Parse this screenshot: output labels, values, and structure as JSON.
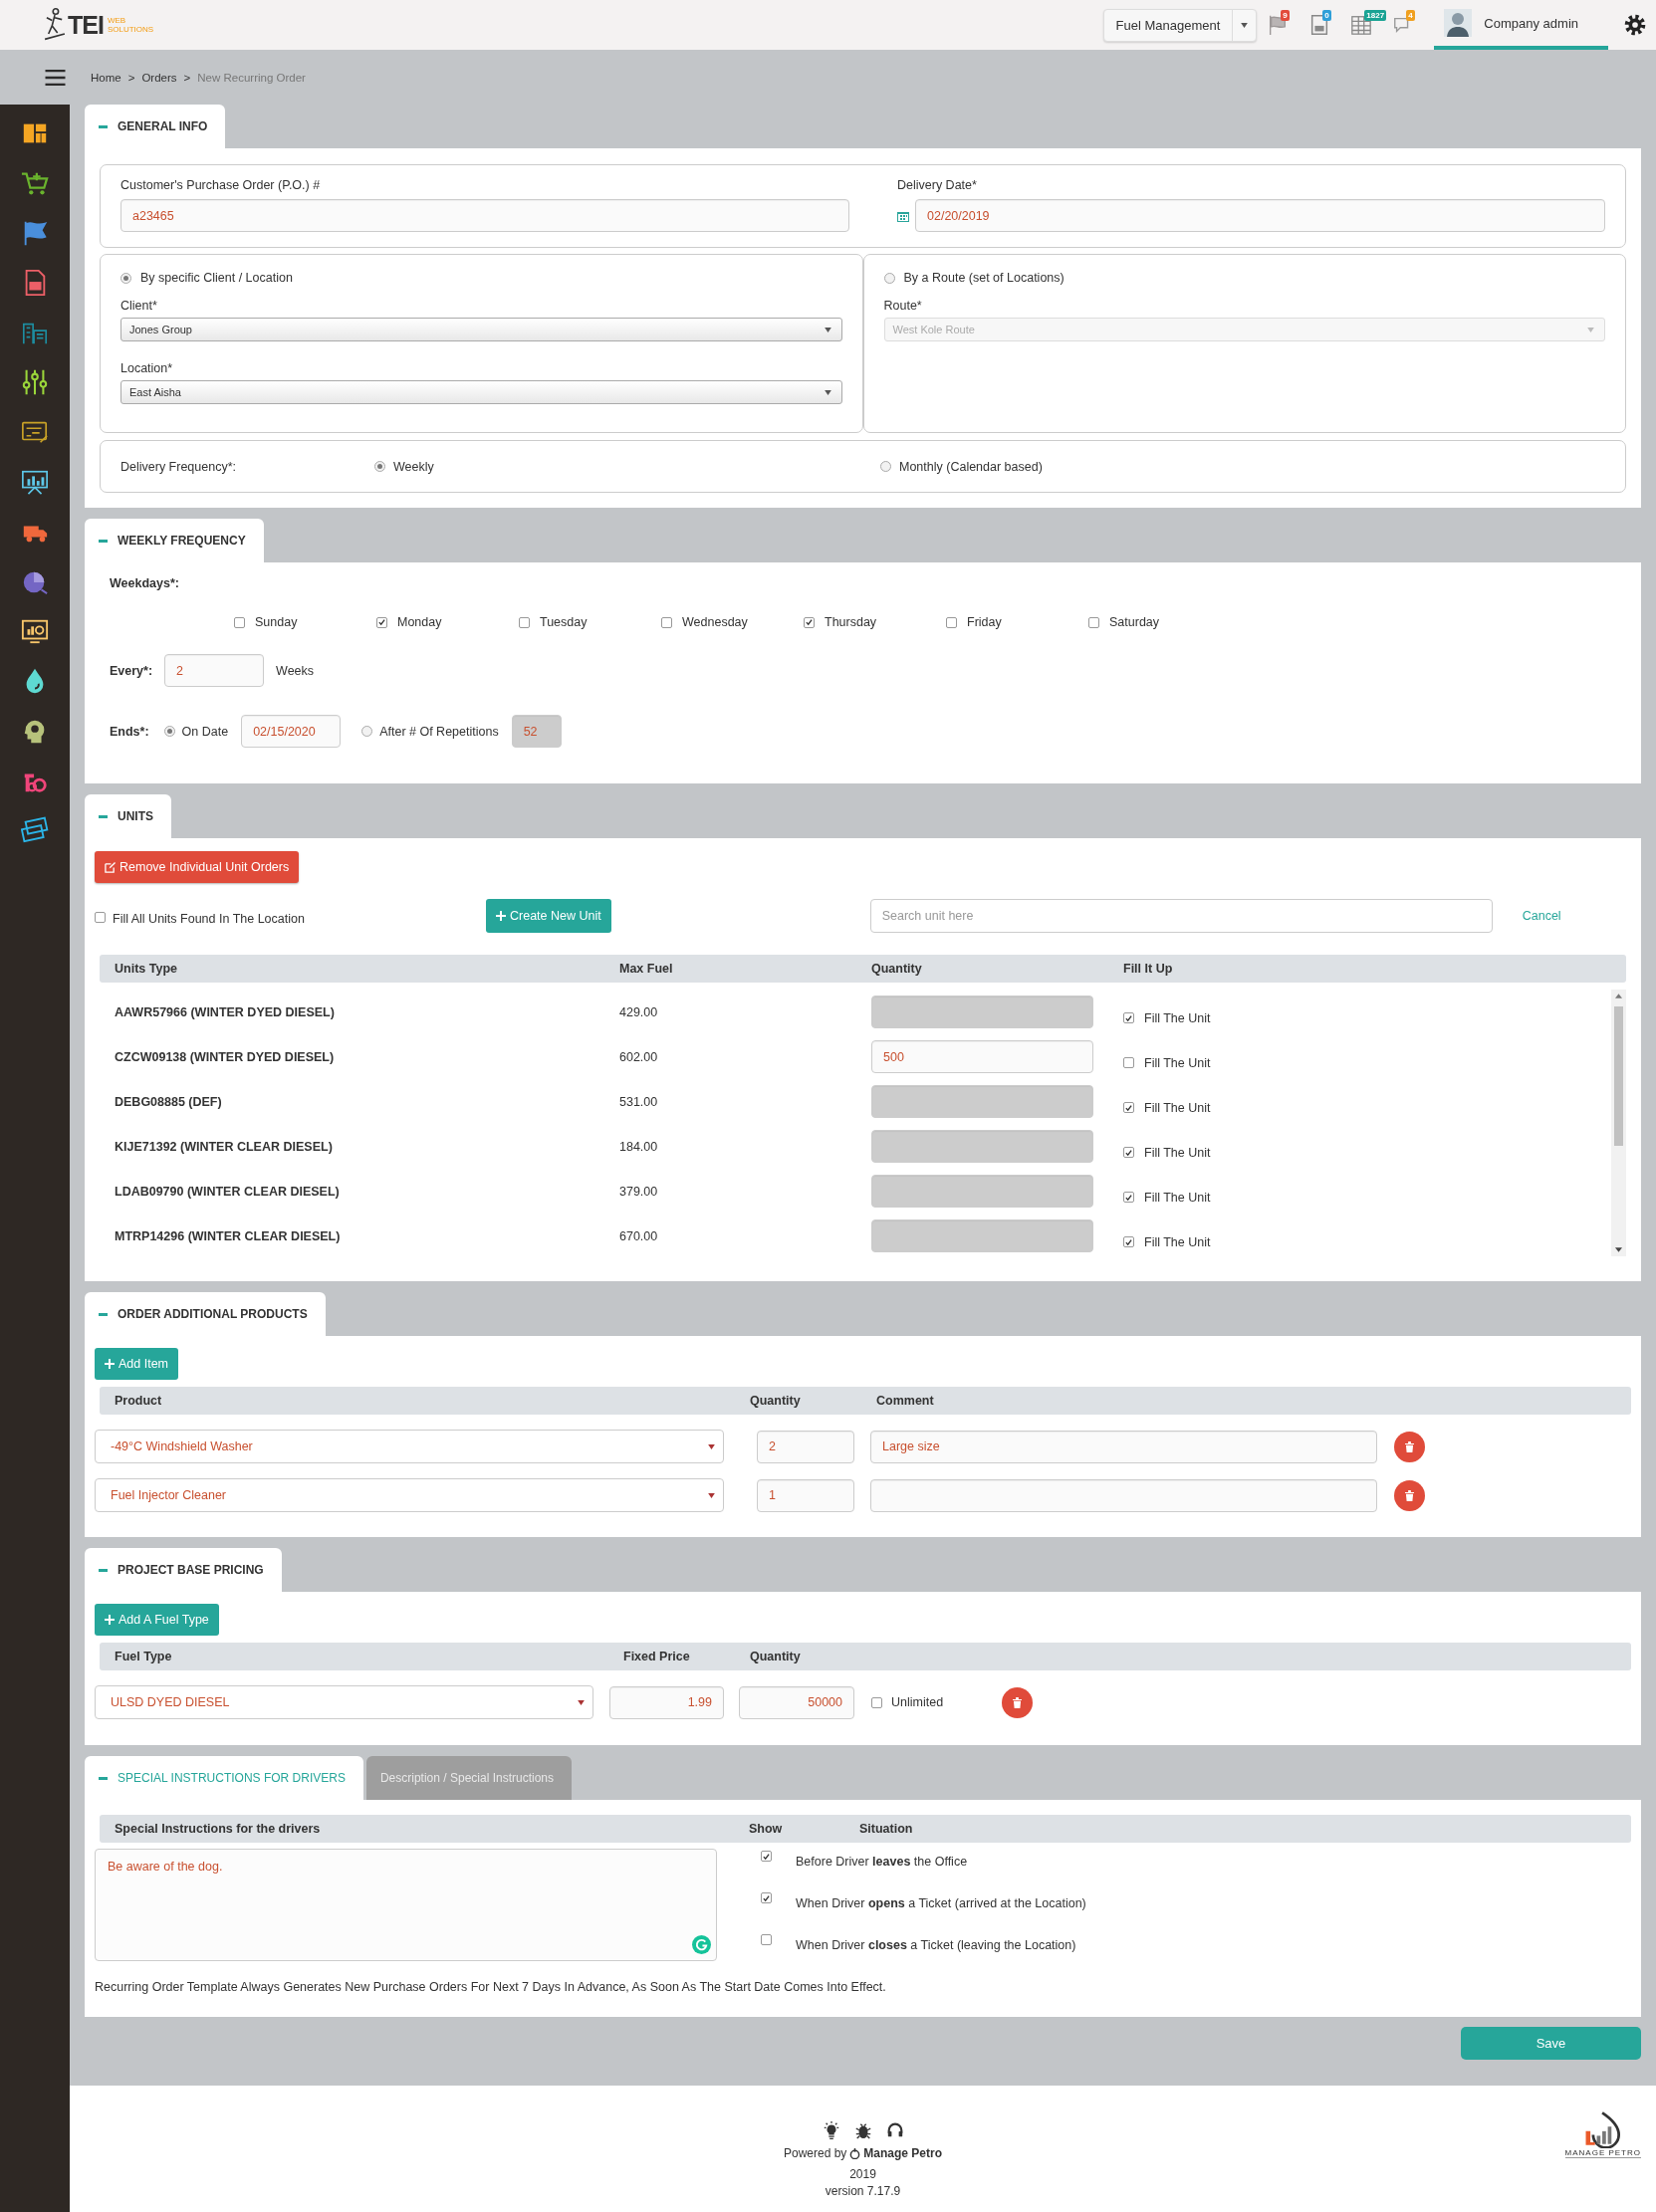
{
  "header": {
    "logo": "TEI",
    "logo_sub": [
      "WEB",
      "SOLUTIONS"
    ],
    "module": "Fuel Management",
    "notifications": [
      {
        "kind": "flag",
        "badge": "9",
        "color": "#e24b3b"
      },
      {
        "kind": "car",
        "badge": "0",
        "color": "#2f9fd8"
      },
      {
        "kind": "table",
        "badge": "1827",
        "color": "#1aa394"
      },
      {
        "kind": "chat",
        "badge": "4",
        "color": "#f0a020"
      }
    ],
    "user": "Company admin"
  },
  "breadcrumb": [
    {
      "kind": "link",
      "label": "Home"
    },
    {
      "kind": "separator",
      "label": ">"
    },
    {
      "kind": "link",
      "label": "Orders"
    },
    {
      "kind": "separator",
      "label": ">"
    },
    {
      "kind": "current",
      "label": "New Recurring Order"
    }
  ],
  "general_info": {
    "title": "GENERAL INFO",
    "po": {
      "label": "Customer's Purchase Order (P.O.) #",
      "value": "a23465"
    },
    "delivery_date": {
      "label": "Delivery Date*",
      "value": "02/20/2019"
    },
    "by_client": {
      "label": "By specific Client / Location",
      "selected": true,
      "client": {
        "label": "Client*",
        "value": "Jones Group"
      },
      "location": {
        "label": "Location*",
        "value": "East Aisha"
      }
    },
    "by_route": {
      "label": "By a Route (set of Locations)",
      "selected": false,
      "route": {
        "label": "Route*",
        "value": "West Kole Route"
      }
    },
    "frequency": {
      "label": "Delivery Frequency*:",
      "options": [
        {
          "label": "Weekly",
          "selected": true
        },
        {
          "label": "Monthly (Calendar based)",
          "selected": false
        }
      ]
    }
  },
  "weekly_frequency": {
    "title": "WEEKLY FREQUENCY",
    "weekdays_label": "Weekdays*:",
    "days": [
      {
        "label": "Sunday",
        "checked": false
      },
      {
        "label": "Monday",
        "checked": true
      },
      {
        "label": "Tuesday",
        "checked": false
      },
      {
        "label": "Wednesday",
        "checked": false
      },
      {
        "label": "Thursday",
        "checked": true
      },
      {
        "label": "Friday",
        "checked": false
      },
      {
        "label": "Saturday",
        "checked": false
      }
    ],
    "every": {
      "label": "Every*:",
      "value": "2",
      "unit": "Weeks"
    },
    "ends": {
      "label": "Ends*:",
      "options": [
        {
          "label": "On Date",
          "selected": true,
          "value": "02/15/2020"
        },
        {
          "label": "After # Of Repetitions",
          "selected": false,
          "value": "52"
        }
      ]
    }
  },
  "units": {
    "title": "UNITS",
    "remove_button": "Remove Individual Unit Orders",
    "fill_all": {
      "label": "Fill All Units Found In The Location",
      "checked": false
    },
    "create_button": "Create New Unit",
    "search": {
      "placeholder": "Search unit here"
    },
    "cancel": "Cancel",
    "columns": [
      "Units Type",
      "Max Fuel",
      "Quantity",
      "Fill It Up"
    ],
    "rows": [
      {
        "unit": "AAWR57966 (WINTER DYED DIESEL)",
        "max_fuel": "429.00",
        "fill": {
          "label": "Fill The Unit",
          "checked": true
        }
      },
      {
        "unit": "CZCW09138 (WINTER DYED DIESEL)",
        "max_fuel": "602.00",
        "quantity": "500",
        "fill": {
          "label": "Fill The Unit",
          "checked": false
        }
      },
      {
        "unit": "DEBG08885 (DEF)",
        "max_fuel": "531.00",
        "fill": {
          "label": "Fill The Unit",
          "checked": true
        }
      },
      {
        "unit": "KIJE71392 (WINTER CLEAR DIESEL)",
        "max_fuel": "184.00",
        "fill": {
          "label": "Fill The Unit",
          "checked": true
        }
      },
      {
        "unit": "LDAB09790 (WINTER CLEAR DIESEL)",
        "max_fuel": "379.00",
        "fill": {
          "label": "Fill The Unit",
          "checked": true
        }
      },
      {
        "unit": "MTRP14296 (WINTER CLEAR DIESEL)",
        "max_fuel": "670.00",
        "fill": {
          "label": "Fill The Unit",
          "checked": true
        }
      }
    ]
  },
  "additional_products": {
    "title": "ORDER ADDITIONAL PRODUCTS",
    "add_button": "Add Item",
    "columns": [
      "Product",
      "Quantity",
      "Comment"
    ],
    "rows": [
      {
        "product": "-49°C Windshield Washer",
        "quantity": "2",
        "comment": "Large size"
      },
      {
        "product": "Fuel Injector Cleaner",
        "quantity": "1"
      }
    ]
  },
  "base_pricing": {
    "title": "PROJECT BASE PRICING",
    "add_button": "Add A Fuel Type",
    "columns": [
      "Fuel Type",
      "Fixed Price",
      "Quantity"
    ],
    "rows": [
      {
        "fuel_type": "ULSD DYED DIESEL",
        "price": "1.99",
        "quantity": "50000",
        "unlimited": {
          "label": "Unlimited",
          "checked": false
        }
      }
    ]
  },
  "special_instructions": {
    "tabs": [
      {
        "label": "SPECIAL INSTRUCTIONS FOR DRIVERS",
        "selected": true
      },
      {
        "label": "Description / Special Instructions",
        "selected": false
      }
    ],
    "columns": [
      "Special Instructions for the drivers",
      "Show",
      "Situation"
    ],
    "text": "Be aware of the dog.",
    "situations": [
      {
        "text": "Before Driver **leaves** the Office",
        "checked": true
      },
      {
        "text": "When Driver **opens** a Ticket (arrived at the Location)",
        "checked": true
      },
      {
        "text": "When Driver **closes** a Ticket (leaving the Location)",
        "checked": false
      }
    ],
    "note": "Recurring Order Template Always Generates New Purchase Orders For Next 7 Days In Advance, As Soon As The Start Date Comes Into Effect."
  },
  "save_button": "Save",
  "footer": {
    "powered_by": "Powered by",
    "brand": "Manage Petro",
    "year": "2019",
    "version": "version 7.17.9",
    "logo_text": "MANAGE PETRO"
  }
}
